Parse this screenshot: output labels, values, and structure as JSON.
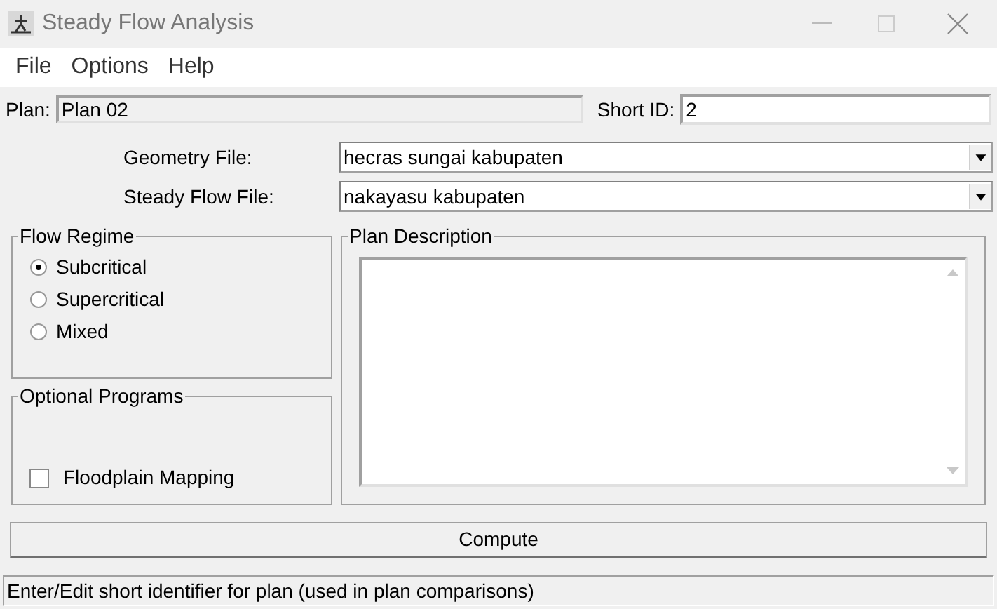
{
  "window": {
    "title": "Steady Flow Analysis"
  },
  "menu": [
    "File",
    "Options",
    "Help"
  ],
  "plan": {
    "label": "Plan:",
    "value": "Plan 02"
  },
  "short_id": {
    "label": "Short ID:",
    "value": "2"
  },
  "files": [
    {
      "label": "Geometry File:",
      "value": "hecras sungai kabupaten"
    },
    {
      "label": "Steady Flow File:",
      "value": "nakayasu kabupaten"
    }
  ],
  "flow_regime": {
    "title": "Flow Regime",
    "options": [
      {
        "label": "Subcritical",
        "selected": true
      },
      {
        "label": "Supercritical",
        "selected": false
      },
      {
        "label": "Mixed",
        "selected": false
      }
    ]
  },
  "optional_programs": {
    "title": "Optional Programs",
    "items": [
      {
        "label": "Floodplain Mapping",
        "checked": false
      }
    ]
  },
  "plan_description": {
    "title": "Plan Description"
  },
  "compute_button": "Compute",
  "status_bar": "Enter/Edit short identifier for plan (used in plan comparisons)"
}
